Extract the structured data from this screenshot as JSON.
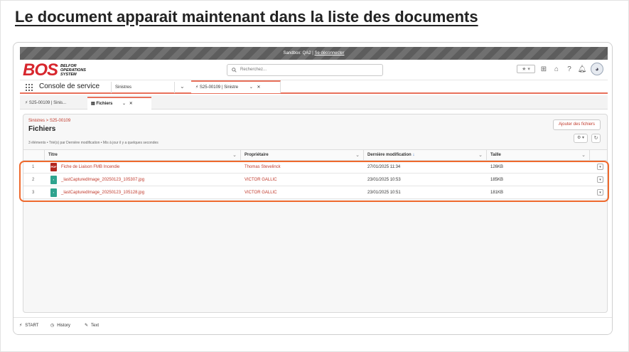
{
  "slide": {
    "title": "Le document apparait maintenant dans la liste des documents"
  },
  "sandbox": {
    "prefix": "Sandbox: QA2 | ",
    "logout": "Se déconnecter"
  },
  "brand": {
    "mark": "BOS",
    "sub1": "BELFOR",
    "sub2": "OPERATIONS",
    "sub3": "SYSTEM",
    "color": "#d7262d"
  },
  "search": {
    "placeholder": "Recherchez..."
  },
  "nav": {
    "app_name": "Console de service",
    "object": "Sinistres",
    "workspace_tab": "S25-00109 | Sinistre"
  },
  "subtabs": [
    {
      "label": "S25-00109 | Sinis..."
    },
    {
      "label": "Fichiers"
    }
  ],
  "page": {
    "breadcrumb": "Sinistres > S25-00109",
    "title": "Fichiers",
    "meta": "3 éléments • Trié(s) par Dernière modification • Mis à jour il y a quelques secondes",
    "add_button": "Ajouter des fichiers"
  },
  "table": {
    "headers": [
      "Titre",
      "Propriétaire",
      "Dernière modification",
      "Taille"
    ],
    "rows": [
      {
        "num": "1",
        "type": "pdf",
        "title": "Fiche de Liaison FMB Incendie",
        "owner": "Thomas Stevelinck",
        "modified": "27/01/2025 11:34",
        "size": "126KB"
      },
      {
        "num": "2",
        "type": "img",
        "title": "_lastCapturedImage_20250123_105307.jpg",
        "owner": "VICTOR GALLIC",
        "modified": "23/01/2025 10:53",
        "size": "185KB"
      },
      {
        "num": "3",
        "type": "img",
        "title": "_lastCapturedImage_20250123_105128.jpg",
        "owner": "VICTOR GALLIC",
        "modified": "23/01/2025 10:51",
        "size": "181KB"
      }
    ]
  },
  "utility": {
    "start": "START",
    "history": "History",
    "text": "Text"
  },
  "colors": {
    "accent": "#e8705b",
    "highlight": "#ef6a2e",
    "link": "#c0392b"
  }
}
